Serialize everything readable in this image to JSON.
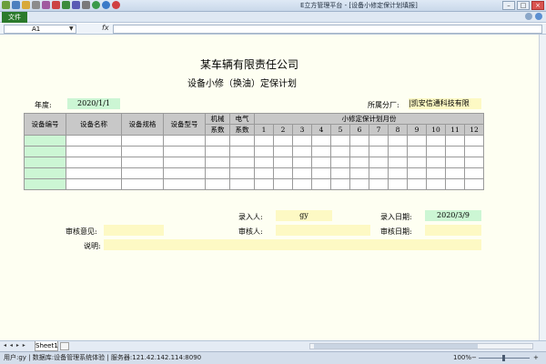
{
  "window": {
    "title": "E立方管理平台 - [设备小修定保计划填报]",
    "file_tab": "文件",
    "buttons": {
      "minimize": "–",
      "maximize": "□",
      "close": "×"
    }
  },
  "formula_bar": {
    "cell_ref": "A1",
    "fx_label": "fx",
    "formula": ""
  },
  "form": {
    "title": "某车辆有限责任公司",
    "subtitle": "设备小修（换油）定保计划",
    "year_label": "年度:",
    "year_value": "2020/1/1",
    "branch_label": "所属分厂:",
    "branch_value": "|凯安信通科技有限",
    "entry_person_label": "录入人:",
    "entry_person_value": "gy",
    "entry_date_label": "录入日期:",
    "entry_date_value": "2020/3/9",
    "review_opinion_label": "审核意见:",
    "reviewer_label": "审核人:",
    "review_date_label": "审核日期:",
    "note_label": "说明:"
  },
  "table": {
    "columns": [
      "设备编号",
      "设备名称",
      "设备规格",
      "设备型号"
    ],
    "mech_coef": [
      "机械",
      "系数"
    ],
    "elec_coef": [
      "电气",
      "系数"
    ],
    "months_header": "小修定保计划月份",
    "months": [
      "1",
      "2",
      "3",
      "4",
      "5",
      "6",
      "7",
      "8",
      "9",
      "10",
      "11",
      "12"
    ],
    "empty_rows": 5
  },
  "sheet_tabs": {
    "nav": "◂ ◂ ▸ ▸",
    "active": "Sheet1"
  },
  "status": {
    "text": "用户:gy | 数据库:设备管理系统体验 | 服务器:121.42.142.114:8090",
    "zoom": "100%",
    "zoom_minus": "−",
    "zoom_plus": "+"
  },
  "colors": {
    "sheet_bg": "#fefff2",
    "field_yellow": "#fdf9c4",
    "field_green": "#ccf6d4",
    "header_gray": "#c8c8c8",
    "file_tab_green": "#2b7a2b"
  }
}
